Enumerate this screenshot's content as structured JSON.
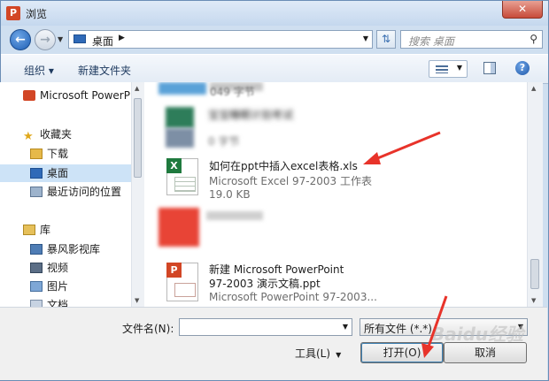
{
  "window": {
    "title": "浏览",
    "close_label": "✕"
  },
  "nav": {
    "back_label": "←",
    "forward_label": "→",
    "address": {
      "location": "桌面"
    },
    "refresh_label": "⇅",
    "search": {
      "placeholder": "搜索 桌面"
    }
  },
  "toolbar": {
    "organize": "组织 ▾",
    "new_folder": "新建文件夹",
    "help_label": "?"
  },
  "sidebar": {
    "items": [
      {
        "label": "Microsoft PowerP",
        "icon": "powerpoint-icon"
      },
      {
        "label": "收藏夹",
        "icon": "star-icon"
      },
      {
        "label": "下载",
        "icon": "download-folder-icon"
      },
      {
        "label": "桌面",
        "icon": "desktop-icon",
        "selected": true
      },
      {
        "label": "最近访问的位置",
        "icon": "recent-places-icon"
      },
      {
        "label": "库",
        "icon": "library-icon"
      },
      {
        "label": "暴风影视库",
        "icon": "video-library-icon"
      },
      {
        "label": "视频",
        "icon": "video-icon"
      },
      {
        "label": "图片",
        "icon": "pictures-icon"
      },
      {
        "label": "文档",
        "icon": "documents-icon"
      }
    ]
  },
  "files": [
    {
      "line2": "049 字节",
      "blurred": true
    },
    {
      "name": "宝宝睡眠计划考试",
      "line2": "0 字节",
      "blurred": true
    },
    {
      "name": "如何在ppt中插入excel表格.xls",
      "type": "Microsoft Excel 97-2003 工作表",
      "size": "19.0 KB",
      "icon": "excel-file-icon"
    },
    {
      "blurred": true
    },
    {
      "name_line1": "新建 Microsoft PowerPoint",
      "name_line2": "97-2003 演示文稿.ppt",
      "type": "Microsoft PowerPoint 97-2003...",
      "icon": "powerpoint-file-icon"
    }
  ],
  "bottom": {
    "filename_label": "文件名(N):",
    "filename_value": "",
    "filetype_value": "所有文件 (*.*)",
    "tools_label": "工具(L)",
    "open_label": "打开(O)",
    "cancel_label": "取消"
  },
  "watermark": "Baidu经验",
  "colors": {
    "accent": "#1f5fb5",
    "annotation_arrow": "#e8332a",
    "excel": "#1f7a3e",
    "powerpoint": "#d24625"
  }
}
